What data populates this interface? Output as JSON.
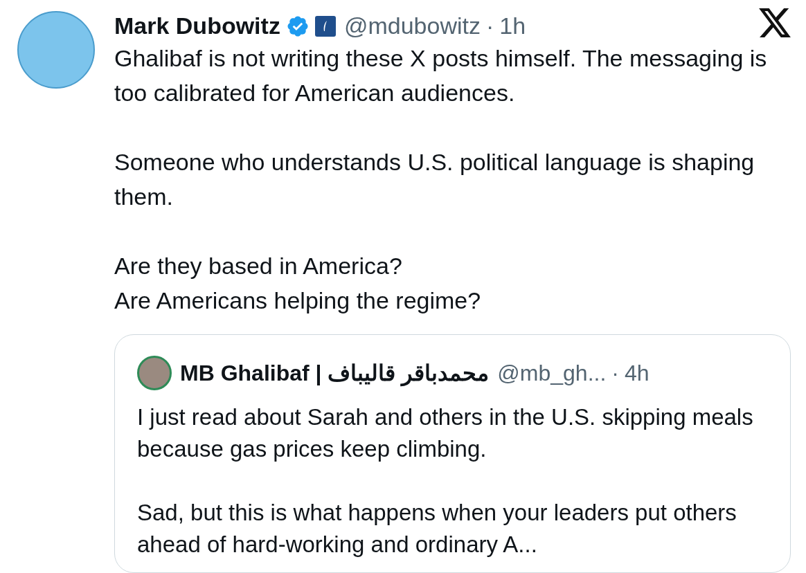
{
  "post": {
    "author": {
      "name": "Mark Dubowitz",
      "verified": true,
      "affiliate": true,
      "handle": "@mdubowitz",
      "separator": "·",
      "time": "1h"
    },
    "paragraphs": [
      "Ghalibaf is not writing these X posts himself. The messaging is too calibrated for American audiences.",
      "Someone who understands U.S. political language is shaping them.",
      "Are they based in America?\nAre Americans helping the regime?"
    ],
    "quote": {
      "author": {
        "name": "MB Ghalibaf | محمدباقر قالیباف",
        "handle": "@mb_gh...",
        "separator": "·",
        "time": "4h"
      },
      "paragraphs": [
        "I just read about Sarah and others in the U.S. skipping meals because gas prices keep climbing.",
        "Sad, but this is what happens when your leaders put others ahead of hard-working and ordinary A..."
      ]
    }
  }
}
